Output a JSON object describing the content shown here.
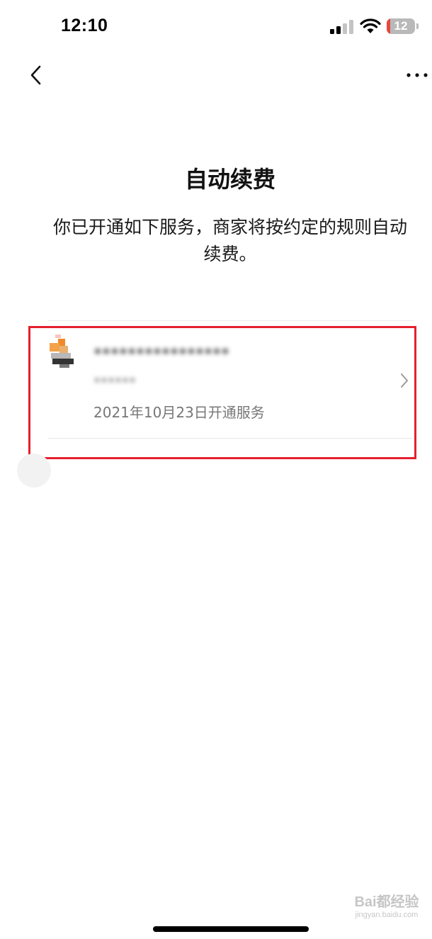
{
  "status_bar": {
    "time": "12:10",
    "battery_level": "12",
    "battery_percent": 12
  },
  "nav": {
    "back_icon": "chevron-left-icon",
    "more_icon": "more-horizontal-icon"
  },
  "page": {
    "title": "自动续费",
    "description": "你已开通如下服务，商家将按约定的规则自动续费。"
  },
  "subscription": {
    "merchant_name": "****************",
    "merchant_subtext": "******",
    "activation_date": "2021年10月23日开通服务",
    "avatar_icon": "merchant-logo-icon",
    "chevron_icon": "chevron-right-icon"
  },
  "colors": {
    "highlight": "#e5202d",
    "battery_low": "#e5483d"
  },
  "watermark": {
    "logo": "Bai都经验",
    "url": "jingyan.baidu.com"
  }
}
